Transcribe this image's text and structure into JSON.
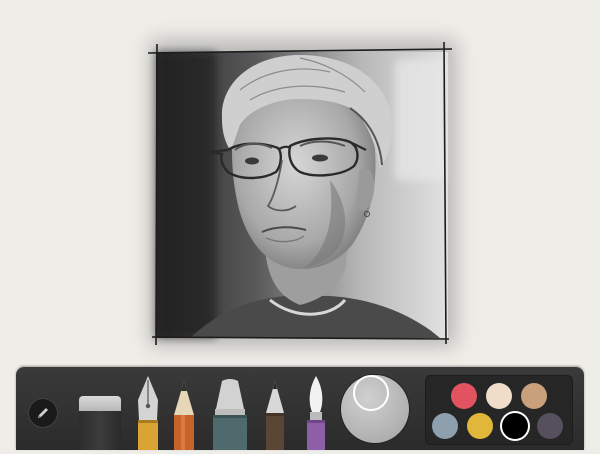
{
  "canvas": {
    "artwork": "pencil-sketch-portrait"
  },
  "toolbar": {
    "tools": [
      {
        "name": "color-picker",
        "icon": "pencil-icon"
      },
      {
        "name": "eraser",
        "icon": "eraser-icon"
      },
      {
        "name": "fountain-pen",
        "icon": "fountain-pen-icon",
        "band_color": "#d9a431"
      },
      {
        "name": "pencil",
        "icon": "pencil-icon",
        "band_color": "#c8622b"
      },
      {
        "name": "marker",
        "icon": "marker-icon",
        "band_color": "#4f6a6c"
      },
      {
        "name": "pen",
        "icon": "pen-icon",
        "band_color": "#5a4634"
      },
      {
        "name": "watercolor-brush",
        "icon": "brush-icon",
        "band_color": "#8d5fa8"
      },
      {
        "name": "color-mixer",
        "icon": "mixer-icon"
      }
    ]
  },
  "palette": {
    "selected_index": 6,
    "swatches": [
      {
        "name": "red",
        "color": "#e25361"
      },
      {
        "name": "cream",
        "color": "#efdcc9"
      },
      {
        "name": "tan",
        "color": "#c9a07c"
      },
      {
        "name": "slate-blue",
        "color": "#8ea0ad"
      },
      {
        "name": "mustard",
        "color": "#e0b73a"
      },
      {
        "name": "black",
        "color": "#000000"
      },
      {
        "name": "plum",
        "color": "#564f5e"
      }
    ]
  }
}
